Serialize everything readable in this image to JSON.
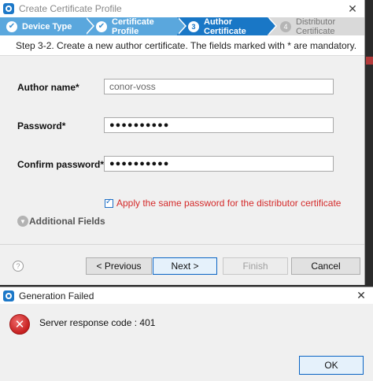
{
  "main_dialog": {
    "title": "Create Certificate Profile",
    "close_glyph": "✕",
    "steps": [
      {
        "number": "",
        "label": "Device Type",
        "state": "done"
      },
      {
        "number": "",
        "label": "Certificate Profile",
        "state": "done"
      },
      {
        "number": "3",
        "label": "Author Certificate",
        "state": "active"
      },
      {
        "number": "4",
        "label": "Distributor Certificate",
        "state": "pending"
      }
    ],
    "instruction": "Step 3-2. Create a new author certificate. The fields marked with * are mandatory.",
    "fields": {
      "author_name": {
        "label": "Author name*",
        "value": "conor-voss"
      },
      "password": {
        "label": "Password*",
        "value": "●●●●●●●●●●"
      },
      "confirm_password": {
        "label": "Confirm password*",
        "value": "●●●●●●●●●●"
      }
    },
    "apply_checkbox": {
      "label": "Apply the same password for the distributor certificate",
      "checked": true
    },
    "additional_fields": "Additional Fields",
    "buttons": {
      "help": "?",
      "previous": "< Previous",
      "next": "Next >",
      "finish": "Finish",
      "cancel": "Cancel"
    }
  },
  "error_dialog": {
    "title": "Generation Failed",
    "close_glyph": "✕",
    "icon": "error-icon",
    "message": "Server response code : 401",
    "ok": "OK"
  },
  "colors": {
    "step_done": "#5aa7dd",
    "step_active": "#1977c6",
    "step_pending": "#d9d9d9",
    "error_red": "#d42a2a"
  }
}
